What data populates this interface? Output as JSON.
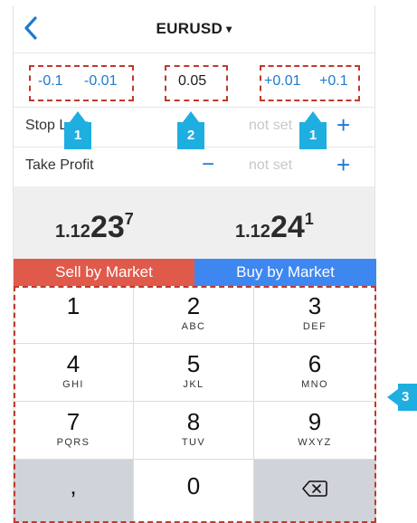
{
  "header": {
    "title": "EURUSD",
    "dropdown_glyph": "▾"
  },
  "steps": {
    "left": [
      "-0.1",
      "-0.01"
    ],
    "lot_value": "0.05",
    "right": [
      "+0.01",
      "+0.1"
    ]
  },
  "stop_loss": {
    "label": "Stop Loss",
    "value": "not set",
    "minus": "−",
    "plus": "+"
  },
  "take_profit": {
    "label": "Take Profit",
    "value": "not set",
    "minus": "−",
    "plus": "+"
  },
  "quotes": {
    "sell": {
      "prefix": "1.12",
      "big": "23",
      "sup": "7"
    },
    "buy": {
      "prefix": "1.12",
      "big": "24",
      "sup": "1"
    }
  },
  "actions": {
    "sell": "Sell by Market",
    "buy": "Buy by Market"
  },
  "keypad": [
    {
      "digit": "1",
      "letters": ""
    },
    {
      "digit": "2",
      "letters": "ABC"
    },
    {
      "digit": "3",
      "letters": "DEF"
    },
    {
      "digit": "4",
      "letters": "GHI"
    },
    {
      "digit": "5",
      "letters": "JKL"
    },
    {
      "digit": "6",
      "letters": "MNO"
    },
    {
      "digit": "7",
      "letters": "PQRS"
    },
    {
      "digit": "8",
      "letters": "TUV"
    },
    {
      "digit": "9",
      "letters": "WXYZ"
    },
    {
      "digit": ",",
      "letters": ""
    },
    {
      "digit": "0",
      "letters": ""
    },
    {
      "digit": "",
      "letters": ""
    }
  ],
  "badges": [
    "1",
    "2",
    "1",
    "3"
  ],
  "colors": {
    "accent": "#1f7ad1",
    "sell": "#e05a4b",
    "buy": "#3e87f0",
    "badge": "#1faee0",
    "annotation": "#c0392b"
  },
  "icons": {
    "back": "chevron-left-icon",
    "backspace": "backspace-icon"
  }
}
